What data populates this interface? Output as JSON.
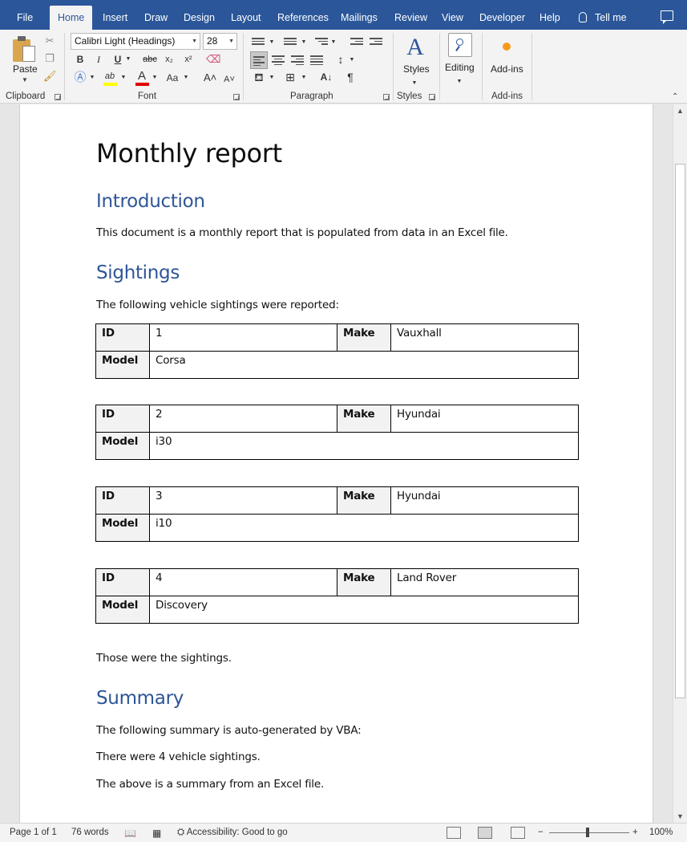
{
  "ribbon_tabs": [
    "File",
    "Home",
    "Insert",
    "Draw",
    "Design",
    "Layout",
    "References",
    "Mailings",
    "Review",
    "View",
    "Developer",
    "Help"
  ],
  "tell_me": "Tell me",
  "clipboard": {
    "paste_label": "Paste",
    "group_label": "Clipboard"
  },
  "font": {
    "name": "Calibri Light (Headings)",
    "size": "28",
    "group_label": "Font",
    "bold": "B",
    "italic": "I",
    "underline": "U",
    "strike": "abc",
    "sub": "x₂",
    "sup": "x²",
    "case": "Aa",
    "grow": "A˄",
    "shrink": "A˅",
    "highlight_color": "#ffff00",
    "font_color": "#e00000"
  },
  "paragraph": {
    "group_label": "Paragraph",
    "pilcrow": "¶"
  },
  "styles": {
    "label": "Styles",
    "group_label": "Styles"
  },
  "editing": {
    "label": "Editing"
  },
  "addins": {
    "label": "Add-ins",
    "group_label": "Add-ins"
  },
  "document": {
    "title": "Monthly report",
    "sections": {
      "intro_heading": "Introduction",
      "intro_text": "This document is a monthly report that is populated from data in an Excel file.",
      "sightings_heading": "Sightings",
      "sightings_intro": "The following vehicle sightings were reported:",
      "sightings_outro": "Those were the sightings.",
      "summary_heading": "Summary",
      "summary_line1": "The following summary is auto-generated by VBA:",
      "summary_line2": "There were 4 vehicle sightings.",
      "summary_line3": "The above is a summary from an Excel file."
    },
    "table_labels": {
      "id": "ID",
      "make": "Make",
      "model": "Model"
    },
    "sightings": [
      {
        "id": "1",
        "make": "Vauxhall",
        "model": "Corsa"
      },
      {
        "id": "2",
        "make": "Hyundai",
        "model": "i30"
      },
      {
        "id": "3",
        "make": "Hyundai",
        "model": "i10"
      },
      {
        "id": "4",
        "make": "Land Rover",
        "model": "Discovery"
      }
    ]
  },
  "status": {
    "page": "Page 1 of 1",
    "words": "76 words",
    "accessibility": "Accessibility: Good to go",
    "zoom": "100%",
    "zoom_minus": "−",
    "zoom_plus": "+"
  },
  "colors": {
    "accent": "#2b579a",
    "heading": "#2f5597"
  }
}
